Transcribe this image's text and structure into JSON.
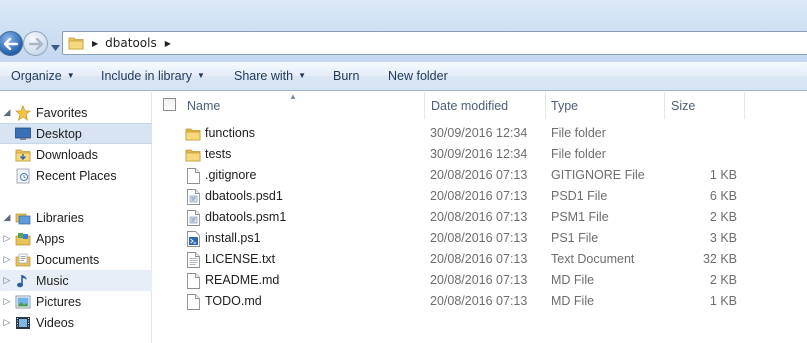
{
  "address": {
    "path": [
      "dbatools"
    ]
  },
  "toolbar": {
    "organize": "Organize",
    "include_in_library": "Include in library",
    "share_with": "Share with",
    "burn": "Burn",
    "new_folder": "New folder"
  },
  "nav": {
    "favorites": "Favorites",
    "desktop": "Desktop",
    "downloads": "Downloads",
    "recent_places": "Recent Places",
    "libraries": "Libraries",
    "apps": "Apps",
    "documents": "Documents",
    "music": "Music",
    "pictures": "Pictures",
    "videos": "Videos"
  },
  "columns": {
    "name": "Name",
    "date_modified": "Date modified",
    "type": "Type",
    "size": "Size"
  },
  "files": [
    {
      "name": "functions",
      "date": "30/09/2016 12:34",
      "type": "File folder",
      "size": "",
      "icon": "folder-icon"
    },
    {
      "name": "tests",
      "date": "30/09/2016 12:34",
      "type": "File folder",
      "size": "",
      "icon": "folder-icon"
    },
    {
      "name": ".gitignore",
      "date": "20/08/2016 07:13",
      "type": "GITIGNORE File",
      "size": "1 KB",
      "icon": "file-icon"
    },
    {
      "name": "dbatools.psd1",
      "date": "20/08/2016 07:13",
      "type": "PSD1 File",
      "size": "6 KB",
      "icon": "script-file-icon"
    },
    {
      "name": "dbatools.psm1",
      "date": "20/08/2016 07:13",
      "type": "PSM1 File",
      "size": "2 KB",
      "icon": "script-file-icon"
    },
    {
      "name": "install.ps1",
      "date": "20/08/2016 07:13",
      "type": "PS1 File",
      "size": "3 KB",
      "icon": "powershell-file-icon"
    },
    {
      "name": "LICENSE.txt",
      "date": "20/08/2016 07:13",
      "type": "Text Document",
      "size": "32 KB",
      "icon": "text-file-icon"
    },
    {
      "name": "README.md",
      "date": "20/08/2016 07:13",
      "type": "MD File",
      "size": "2 KB",
      "icon": "file-icon"
    },
    {
      "name": "TODO.md",
      "date": "20/08/2016 07:13",
      "type": "MD File",
      "size": "1 KB",
      "icon": "file-icon"
    }
  ]
}
